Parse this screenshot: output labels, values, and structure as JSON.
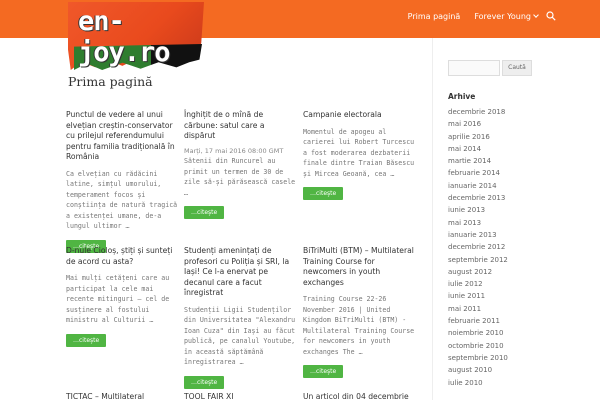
{
  "header": {
    "logo_text": "en-joy.ro",
    "nav": [
      {
        "label": "Prima pagină"
      },
      {
        "label": "Forever Young"
      }
    ]
  },
  "page": {
    "title": "Prima pagină"
  },
  "colors": {
    "accent": "#f46a22",
    "button": "#50b543"
  },
  "posts": [
    {
      "title": "Punctul de vedere al unui elvețian creștin-conservator cu prilejul referendumului pentru familia tradițională în România",
      "meta": "",
      "excerpt": "Ca elvețian cu rădăcini latine, simțul umorului, temperament focos și conștiința de natură tragică a existenței umane, de-a lungul ultimor …",
      "button": "…citeşte"
    },
    {
      "title": "Înghițit de o mînă de cărbune: satul care a dispărut",
      "meta": "Marți, 17 mai 2016 08:00 GMT",
      "excerpt": "Sătenii din Runcurel au primit un termen de 30 de zile să-și părăsească casele …",
      "button": "…citeşte"
    },
    {
      "title": "Campanie electorala",
      "meta": "",
      "excerpt": "Momentul de apogeu al carierei lui Robert Turcescu a fost moderarea dezbaterii finale dintre Traian Băsescu și Mircea Geoană, cea …",
      "button": "…citeşte"
    },
    {
      "title": "D-nule Cioloș, știți și sunteți de acord cu asta?",
      "meta": "",
      "excerpt": "Mai mulți cetățeni care au participat la cele mai recente mitinguri – cel de susținere al fostului ministru al Culturii …",
      "button": "…citeşte"
    },
    {
      "title": "Studenți amenințați de profesori cu Poliția și SRI, la Iași! Ce l-a enervat pe decanul care a facut înregistrat",
      "meta": "",
      "excerpt": "Studenții Ligii Studenților din Universitatea \"Alexandru Ioan Cuza\" din Iași au făcut publică, pe canalul Youtube, în această săptămână înregistrarea …",
      "button": "…citeşte"
    },
    {
      "title": "BiTriMulti (BTM) – Multilateral Training Course for newcomers in youth exchanges",
      "meta": "",
      "excerpt": "Training Course 22-26 November 2016 | United Kingdom BiTriMulti (BTM) - Multilateral Training Course for newcomers in youth exchanges The …",
      "button": "…citeşte"
    },
    {
      "title": "TICTAC – Multilateral",
      "meta": "",
      "excerpt": "",
      "button": ""
    },
    {
      "title": "TOOL FAIR XI",
      "meta": "",
      "excerpt": "",
      "button": ""
    },
    {
      "title": "Un articol din 04 decembrie",
      "meta": "",
      "excerpt": "",
      "button": ""
    }
  ],
  "sidebar": {
    "search_button": "Caută",
    "archive_title": "Arhive",
    "archives": [
      "decembrie 2018",
      "mai 2016",
      "aprilie 2016",
      "mai 2014",
      "martie 2014",
      "februarie 2014",
      "ianuarie 2014",
      "decembrie 2013",
      "iunie 2013",
      "mai 2013",
      "ianuarie 2013",
      "decembrie 2012",
      "septembrie 2012",
      "august 2012",
      "iulie 2012",
      "iunie 2011",
      "mai 2011",
      "februarie 2011",
      "noiembrie 2010",
      "octombrie 2010",
      "septembrie 2010",
      "august 2010",
      "iulie 2010"
    ]
  }
}
